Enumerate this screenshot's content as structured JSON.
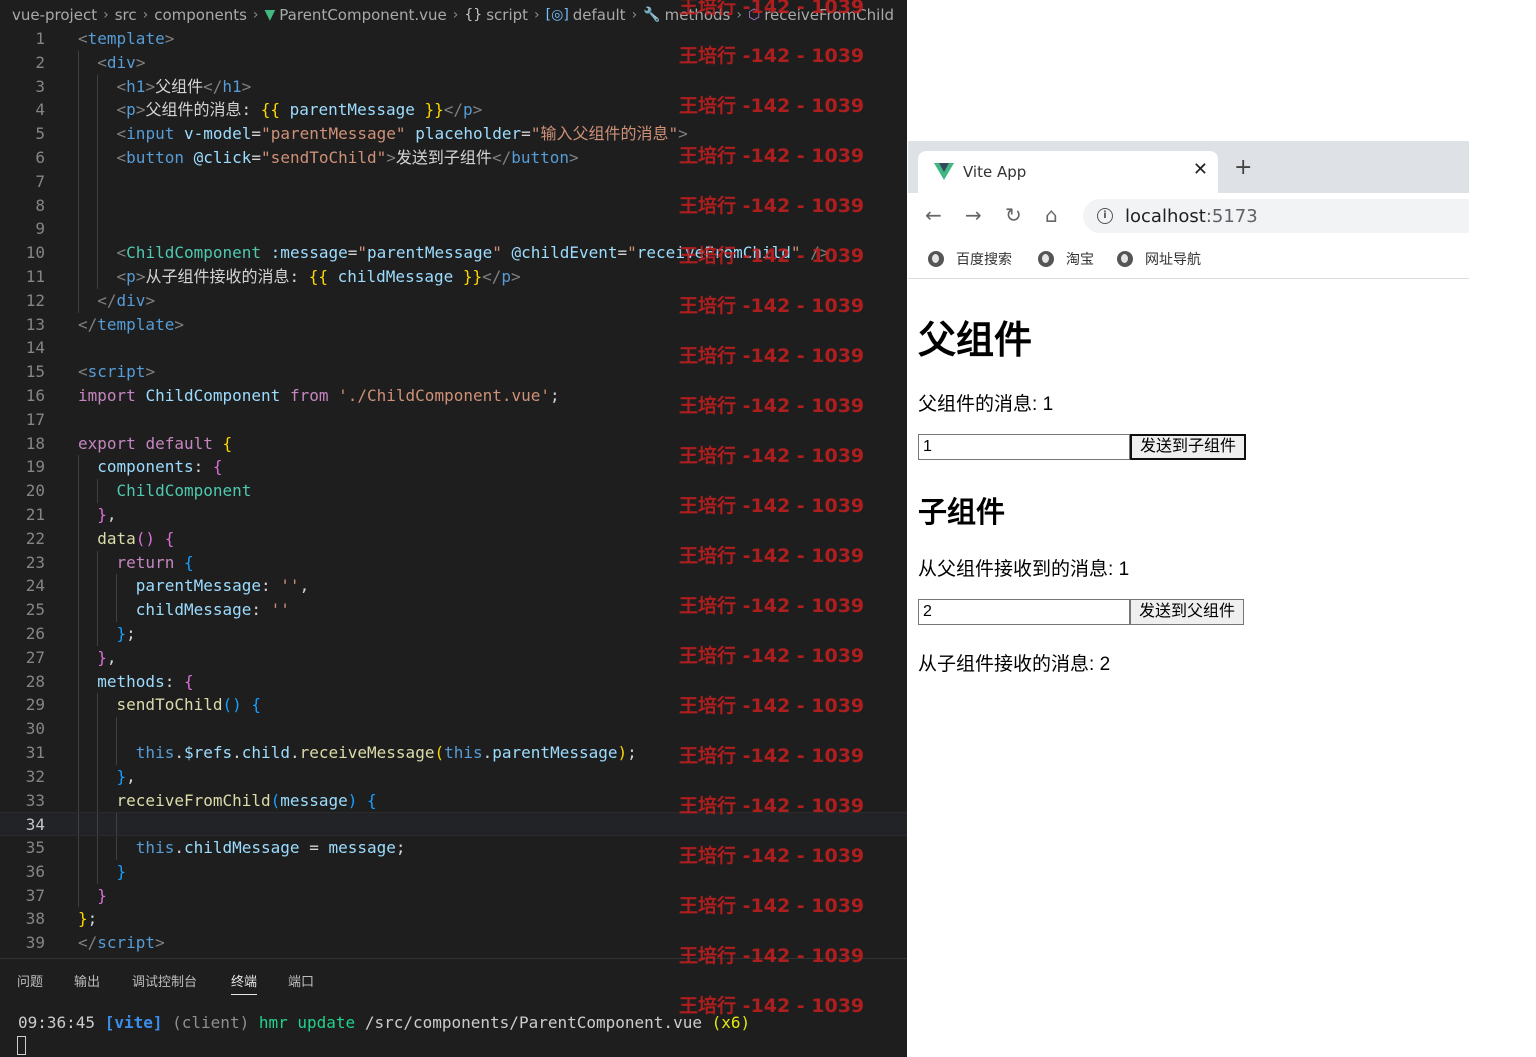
{
  "breadcrumb": {
    "items": [
      "vue-project",
      "src",
      "components",
      "ParentComponent.vue",
      "script",
      "default",
      "methods",
      "receiveFromChild"
    ],
    "icons": {
      "file": "vue-logo-icon",
      "script": "braces-icon",
      "default": "symbol-variable-icon",
      "methods": "wrench-icon",
      "receiveFromChild": "method-cube-icon"
    }
  },
  "editor": {
    "line_numbers": [
      "1",
      "2",
      "3",
      "4",
      "5",
      "6",
      "7",
      "8",
      "9",
      "10",
      "11",
      "12",
      "13",
      "14",
      "15",
      "16",
      "17",
      "18",
      "19",
      "20",
      "21",
      "22",
      "23",
      "24",
      "25",
      "26",
      "27",
      "28",
      "29",
      "30",
      "31",
      "32",
      "33",
      "34",
      "35",
      "36",
      "37",
      "38",
      "39"
    ],
    "active_line": "34",
    "code": {
      "l3_h1_text": "父组件",
      "l4_p_text": "父组件的消息: ",
      "l4_mus_open": "{{",
      "l4_var": " parentMessage ",
      "l4_mus_close": "}}",
      "l5_placeholder": "\"输入父组件的消息\"",
      "l6_button_text": "发送到子组件",
      "l11_p_text": "从子组件接收的消息: ",
      "l11_var": " childMessage "
    }
  },
  "panel": {
    "tabs": [
      "问题",
      "输出",
      "调试控制台",
      "终端",
      "端口"
    ],
    "active_tab": "终端",
    "terminal": {
      "time": "09:36:45",
      "vite": "[vite]",
      "client": "(client)",
      "hmr": "hmr update",
      "path": "/src/components/ParentComponent.vue",
      "count": "(x6)"
    }
  },
  "watermark": {
    "text": "王培行 -142 - 1039",
    "color": "#c81e1e"
  },
  "browser": {
    "tab_title": "Vite App",
    "url_host": "localhost",
    "url_port": ":5173",
    "bookmarks": [
      "百度搜索",
      "淘宝",
      "网址导航"
    ],
    "page": {
      "parent_heading": "父组件",
      "parent_message_label": "父组件的消息: ",
      "parent_message_value": "1",
      "parent_input_value": "1",
      "send_to_child_label": "发送到子组件",
      "child_heading": "子组件",
      "child_received_label": "从父组件接收到的消息: ",
      "child_received_value": "1",
      "child_input_value": "2",
      "send_to_parent_label": "发送到父组件",
      "from_child_label": "从子组件接收的消息: ",
      "from_child_value": "2"
    }
  },
  "colors": {
    "editor_bg": "#1e1e1e",
    "vue_green": "#42b883",
    "tag_blue": "#569cd6",
    "string_orange": "#ce9178",
    "keyword_purple": "#c586c0"
  }
}
